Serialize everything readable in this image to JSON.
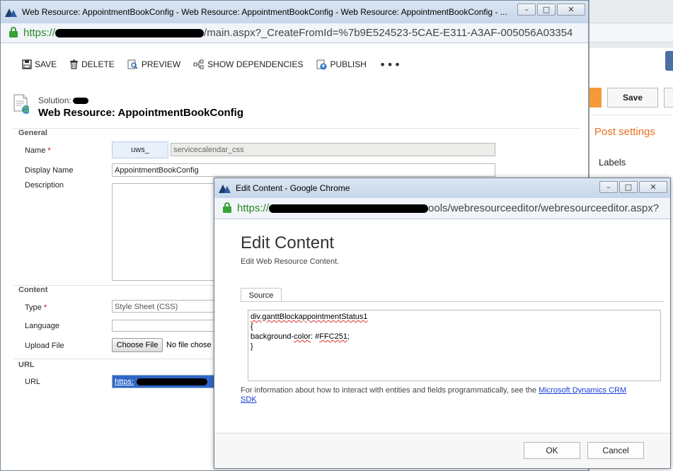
{
  "background_page": {
    "save_label": "Save",
    "post_settings": "Post settings",
    "labels": "Labels"
  },
  "main_window": {
    "title": "Web Resource: AppointmentBookConfig - Web Resource: AppointmentBookConfig - Web Resource: AppointmentBookConfig - ...",
    "url_scheme": "https://",
    "url_rest": "/main.aspx?_CreateFromId=%7b9E524523-5CAE-E311-A3AF-005056A03354",
    "toolbar": {
      "save": "SAVE",
      "delete": "DELETE",
      "preview": "PREVIEW",
      "show_dependencies": "SHOW DEPENDENCIES",
      "publish": "PUBLISH",
      "more": "•••"
    },
    "solution_label": "Solution:",
    "page_title": "Web Resource: AppointmentBookConfig",
    "sections": {
      "general": "General",
      "content": "Content",
      "url": "URL"
    },
    "fields": {
      "name_label": "Name",
      "name_prefix": "uws_",
      "name_value": "servicecalendar_css",
      "display_name_label": "Display Name",
      "display_name_value": "AppointmentBookConfig",
      "description_label": "Description",
      "type_label": "Type",
      "type_value": "Style Sheet (CSS)",
      "language_label": "Language",
      "upload_label": "Upload File",
      "choose_file": "Choose File",
      "no_file": "No file chose",
      "url_label": "URL",
      "url_value": "https:"
    },
    "required_marker": "*"
  },
  "popup": {
    "title": "Edit Content - Google Chrome",
    "url_scheme": "https://",
    "url_rest": "ools/webresourceeditor/webresourceeditor.aspx?",
    "heading": "Edit Content",
    "subheading": "Edit Web Resource Content.",
    "tab_source": "Source",
    "code": {
      "line1": "div.ganttBlockappointmentStatus1",
      "line2": "{",
      "line3a": "background-",
      "line3b": "color",
      "line3c": ": #",
      "line3d": "FFC251",
      "line3e": ";",
      "line4": "}"
    },
    "info_prefix": "For information about how to interact with entities and fields programmatically, see the ",
    "info_link": "Microsoft Dynamics CRM",
    "info_link2": "SDK",
    "ok": "OK",
    "cancel": "Cancel"
  },
  "window_controls": {
    "minimize": "–",
    "maximize": "□",
    "close": "✕"
  }
}
